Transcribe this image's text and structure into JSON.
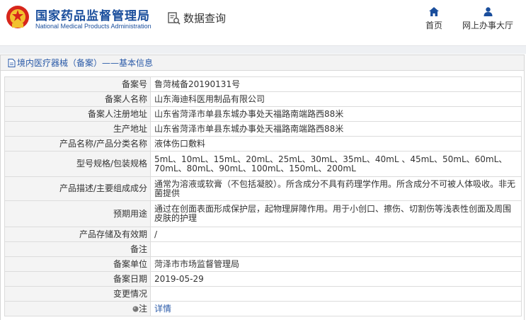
{
  "header": {
    "org_cn": "国家药品监督管理局",
    "org_en": "National Medical Products Administration",
    "query_label": "数据查询",
    "nav": {
      "home": "首页",
      "hall": "网上办事大厅"
    }
  },
  "panel": {
    "title": "境内医疗器械（备案）——基本信息"
  },
  "rows": [
    {
      "label": "备案号",
      "value": "鲁菏械备20190131号"
    },
    {
      "label": "备案人名称",
      "value": "山东海迪科医用制品有限公司"
    },
    {
      "label": "备案人注册地址",
      "value": "山东省菏泽市单县东城办事处天福路南端路西88米"
    },
    {
      "label": "生产地址",
      "value": "山东省菏泽市单县东城办事处天福路南端路西88米"
    },
    {
      "label": "产品名称/产品分类名称",
      "value": "液体伤口敷料"
    },
    {
      "label": "型号规格/包装规格",
      "value": "5mL、10mL、15mL、20mL、25mL、30mL、35mL、40mL 、45mL、50mL、60mL、70mL、80mL、90mL、100mL、150mL、200mL"
    },
    {
      "label": "产品描述/主要组成成分",
      "value": "通常为溶液或软膏（不包括凝胶）。所含成分不具有药理学作用。所含成分不可被人体吸收。非无菌提供"
    },
    {
      "label": "预期用途",
      "value": "通过在创面表面形成保护层，起物理屏障作用。用于小创口、擦伤、切割伤等浅表性创面及周围皮肤的护理"
    },
    {
      "label": "产品存储及有效期",
      "value": "/"
    },
    {
      "label": "备注",
      "value": ""
    },
    {
      "label": "备案单位",
      "value": "菏泽市市场监督管理局"
    },
    {
      "label": "备案日期",
      "value": "2019-05-29"
    },
    {
      "label": "变更情况",
      "value": ""
    },
    {
      "label": "注",
      "value": "详情"
    }
  ],
  "colors": {
    "brand_blue": "#1a4e9c",
    "emblem_red": "#d7261b",
    "link_blue": "#2a5aa8"
  }
}
